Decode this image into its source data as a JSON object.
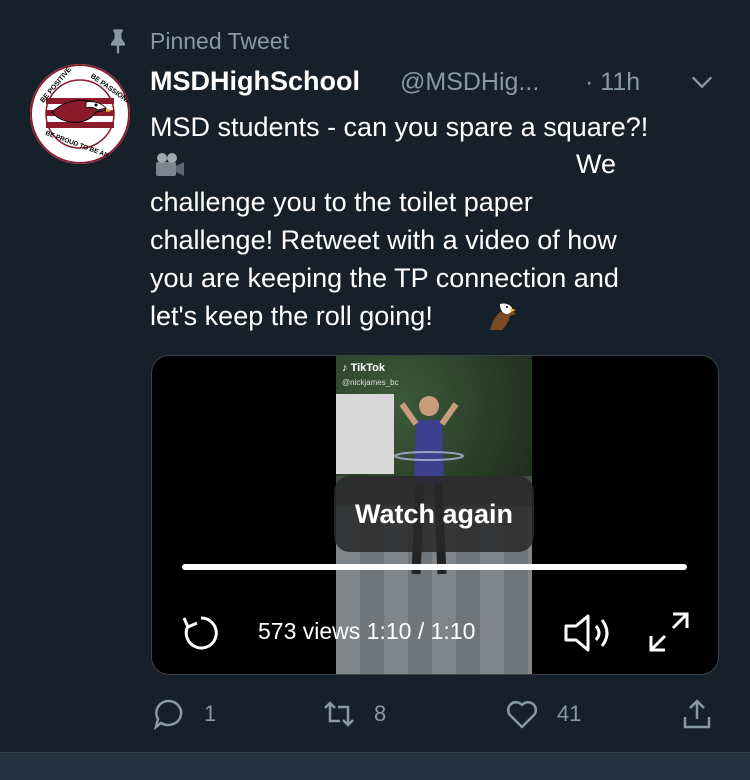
{
  "pinned": {
    "label": "Pinned Tweet",
    "icon": "pin-icon"
  },
  "tweet": {
    "display_name": "MSDHighSchool",
    "handle": "@MSDHig...",
    "time": "· 11h",
    "lines": [
      "MSD students - can you spare a square?!",
      "We",
      "challenge you to the toilet paper",
      "challenge! Retweet with a video of how",
      "you are keeping the TP connection and",
      "let's keep the roll going!"
    ],
    "emojis": [
      "movie-camera-emoji",
      "eagle-emoji"
    ]
  },
  "avatar": {
    "logo_text_top_left": "Be Positive",
    "logo_text_top_right": "Be Passionate",
    "logo_text_bottom": "Be Proud to be an Eagle",
    "colors": {
      "maroon": "#8b1a2b",
      "white": "#ffffff"
    }
  },
  "media": {
    "tiktok_label": "TikTok",
    "tiktok_user": "@nickjames_bc",
    "watch_again": "Watch again",
    "views_time": "573 views 1:10 / 1:10",
    "progress": 1.0
  },
  "actions": {
    "reply_count": "1",
    "retweet_count": "8",
    "like_count": "41"
  },
  "colors": {
    "background": "#15202b",
    "muted_text": "#8899a6",
    "border": "#38444d"
  }
}
